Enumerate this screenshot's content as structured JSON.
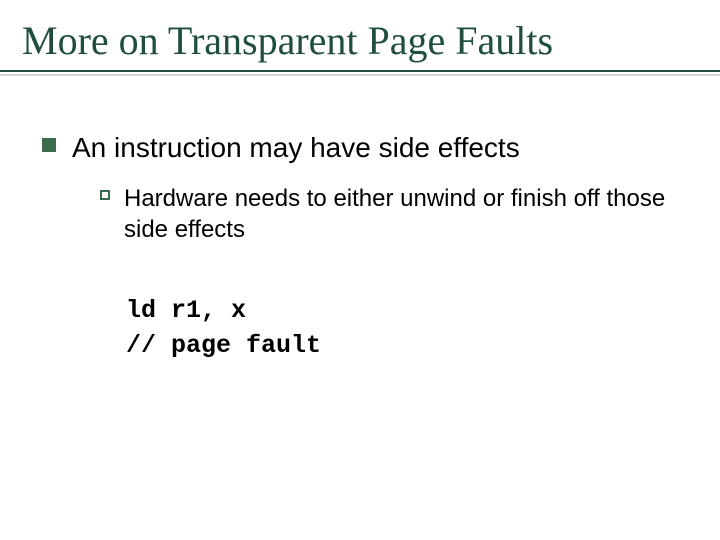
{
  "slide": {
    "title": "More on Transparent Page Faults",
    "level1": "An instruction may have side effects",
    "level2": "Hardware needs to either unwind or finish off those side effects",
    "code": {
      "line1": "ld r1, x",
      "line2": "// page fault"
    }
  }
}
